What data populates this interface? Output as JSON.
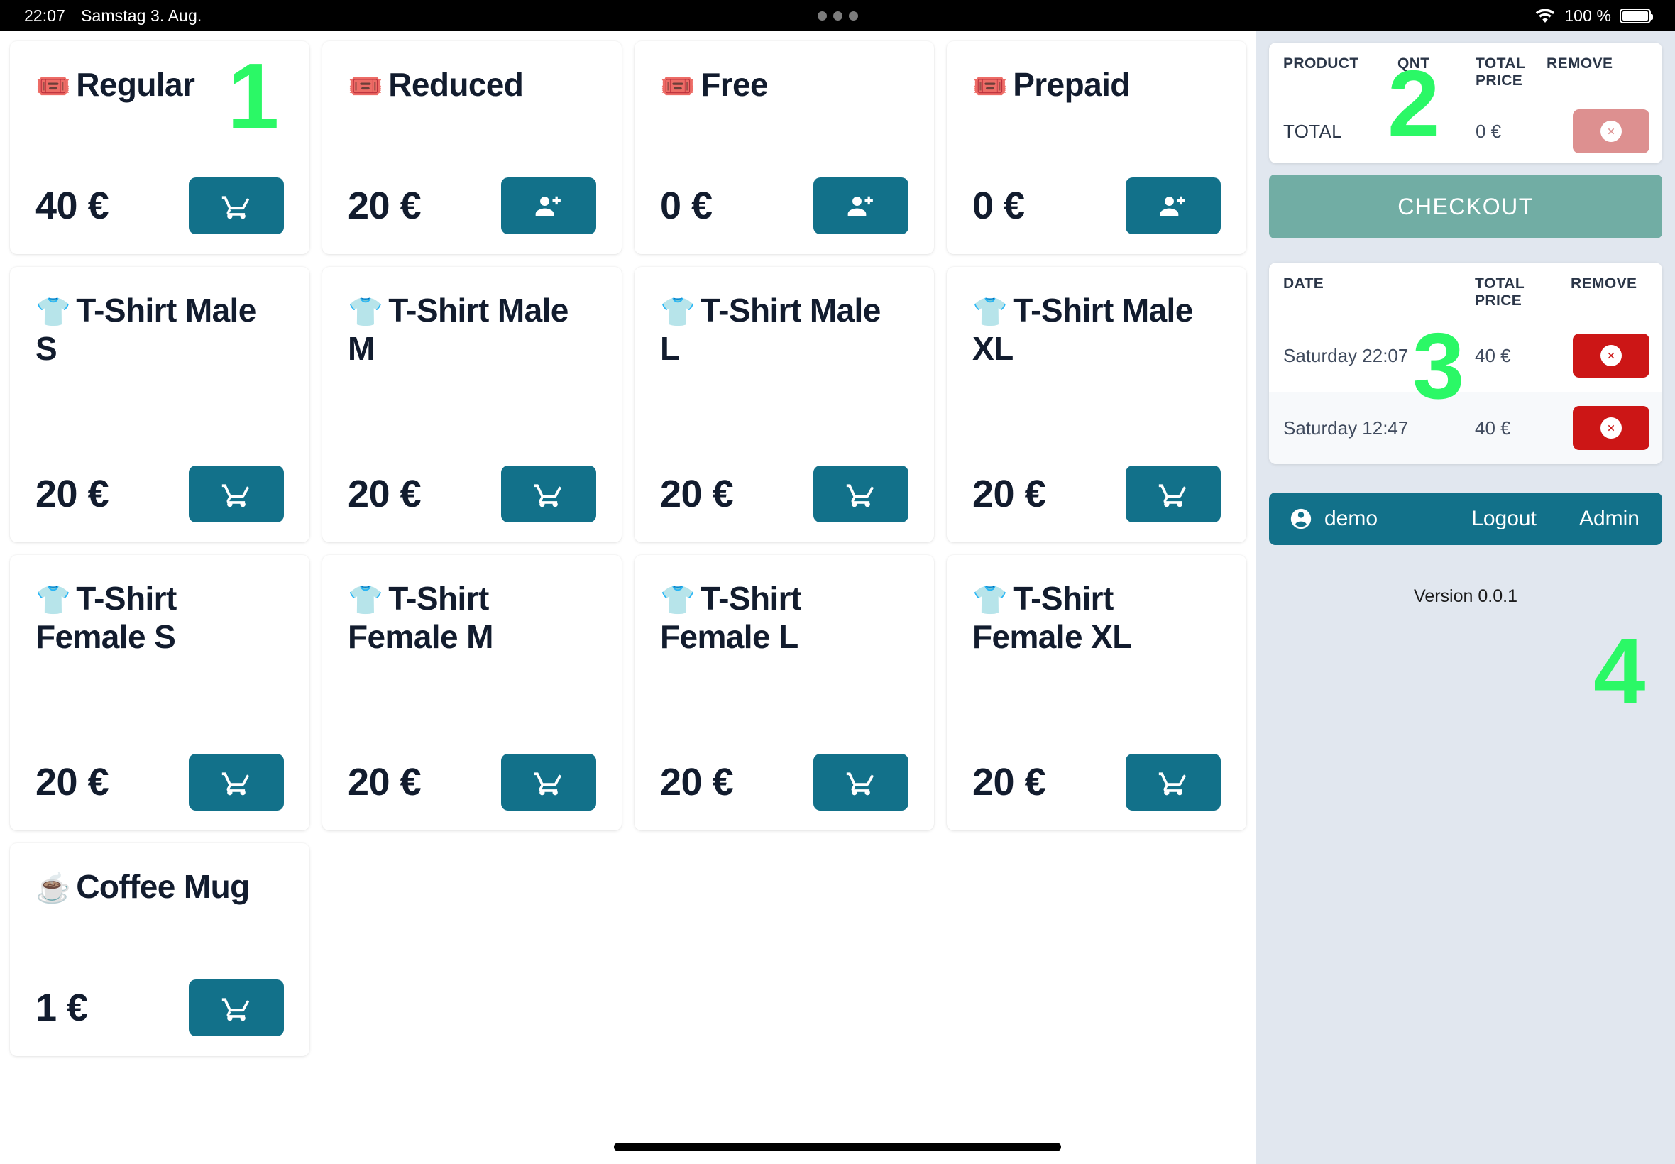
{
  "status_bar": {
    "time": "22:07",
    "date": "Samstag 3. Aug.",
    "battery_percent": "100 %",
    "wifi_icon": "wifi-icon",
    "battery_icon": "battery-full-icon",
    "multitask_icon": "three-dots-icon"
  },
  "products": [
    {
      "emoji": "🎟️",
      "name": "Regular",
      "price": "40 €",
      "action_icon": "shopping-cart-icon",
      "two_line": false
    },
    {
      "emoji": "🎟️",
      "name": "Reduced",
      "price": "20 €",
      "action_icon": "person-add-icon",
      "two_line": false
    },
    {
      "emoji": "🎟️",
      "name": "Free",
      "price": "0 €",
      "action_icon": "person-add-icon",
      "two_line": false
    },
    {
      "emoji": "🎟️",
      "name": "Prepaid",
      "price": "0 €",
      "action_icon": "person-add-icon",
      "two_line": false
    },
    {
      "emoji": "👕",
      "name": "T-Shirt Male S",
      "price": "20 €",
      "action_icon": "shopping-cart-icon",
      "two_line": true
    },
    {
      "emoji": "👕",
      "name": "T-Shirt Male M",
      "price": "20 €",
      "action_icon": "shopping-cart-icon",
      "two_line": true
    },
    {
      "emoji": "👕",
      "name": "T-Shirt Male L",
      "price": "20 €",
      "action_icon": "shopping-cart-icon",
      "two_line": true
    },
    {
      "emoji": "👕",
      "name": "T-Shirt Male XL",
      "price": "20 €",
      "action_icon": "shopping-cart-icon",
      "two_line": true
    },
    {
      "emoji": "👕",
      "name": "T-Shirt Female S",
      "price": "20 €",
      "action_icon": "shopping-cart-icon",
      "two_line": true
    },
    {
      "emoji": "👕",
      "name": "T-Shirt Female M",
      "price": "20 €",
      "action_icon": "shopping-cart-icon",
      "two_line": true
    },
    {
      "emoji": "👕",
      "name": "T-Shirt Female L",
      "price": "20 €",
      "action_icon": "shopping-cart-icon",
      "two_line": true
    },
    {
      "emoji": "👕",
      "name": "T-Shirt Female XL",
      "price": "20 €",
      "action_icon": "shopping-cart-icon",
      "two_line": true
    },
    {
      "emoji": "☕",
      "name": "Coffee Mug",
      "price": "1 €",
      "action_icon": "shopping-cart-icon",
      "two_line": false
    }
  ],
  "cart": {
    "headers": {
      "product": "PRODUCT",
      "qnt": "QNT",
      "total_price": "TOTAL PRICE",
      "remove": "REMOVE"
    },
    "total_row": {
      "label": "TOTAL",
      "qnt": "",
      "total_price": "0 €",
      "remove_icon": "remove-circle-icon",
      "remove_enabled": false
    },
    "checkout_label": "CHECKOUT"
  },
  "history": {
    "headers": {
      "date": "DATE",
      "total_price": "TOTAL PRICE",
      "remove": "REMOVE"
    },
    "rows": [
      {
        "date": "Saturday 22:07",
        "total_price": "40 €",
        "remove_icon": "remove-circle-icon"
      },
      {
        "date": "Saturday 12:47",
        "total_price": "40 €",
        "remove_icon": "remove-circle-icon"
      }
    ]
  },
  "user_bar": {
    "account_icon": "account-circle-icon",
    "username": "demo",
    "logout_label": "Logout",
    "admin_label": "Admin"
  },
  "footer": {
    "version": "Version 0.0.1"
  },
  "annotations": [
    {
      "id": "anno-1",
      "label": "1"
    },
    {
      "id": "anno-2",
      "label": "2"
    },
    {
      "id": "anno-3",
      "label": "3"
    },
    {
      "id": "anno-4",
      "label": "4"
    }
  ],
  "colors": {
    "accent_teal": "#12718a",
    "checkout_green": "#71ada4",
    "remove_red": "#cc1616",
    "remove_red_disabled": "#dd9090",
    "sidebar_bg": "#e1e7ef",
    "annotation_green": "#2bf866",
    "text_dark": "#121c2e"
  }
}
